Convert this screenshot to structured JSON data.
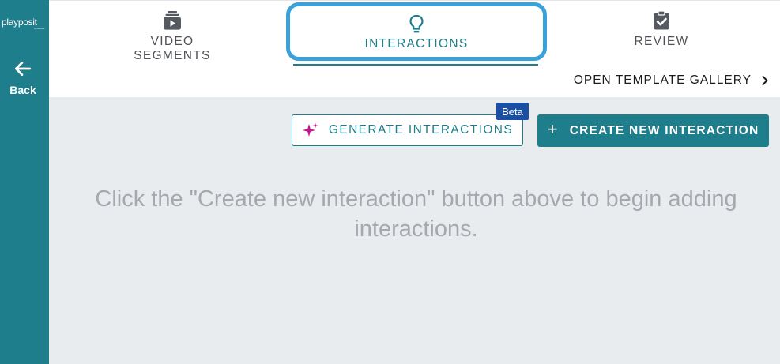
{
  "sidebar": {
    "logo_text": "playposit",
    "logo_subtext": "by Ascensia",
    "back_label": "Back"
  },
  "tabs": [
    {
      "label": "VIDEO SEGMENTS",
      "icon": "video-stack-icon",
      "active": false
    },
    {
      "label": "INTERACTIONS",
      "icon": "lightbulb-icon",
      "active": true
    },
    {
      "label": "REVIEW",
      "icon": "clipboard-check-icon",
      "active": false
    }
  ],
  "template_gallery": {
    "label": "OPEN TEMPLATE GALLERY",
    "icon": "chevron-right-icon"
  },
  "actions": {
    "generate_label": "GENERATE INTERACTIONS",
    "generate_icon": "sparkle-icon",
    "beta_label": "Beta",
    "create_plus": "+",
    "create_label": "CREATE NEW INTERACTION"
  },
  "empty_state": {
    "message": "Click the \"Create new interaction\" button above to begin adding interactions."
  },
  "colors": {
    "brand_teal": "#1f7e8b",
    "highlight_blue": "#3aa1d9",
    "beta_blue": "#1b4fa4",
    "sparkle_magenta": "#c2148f",
    "main_bg": "#e9ecef"
  }
}
